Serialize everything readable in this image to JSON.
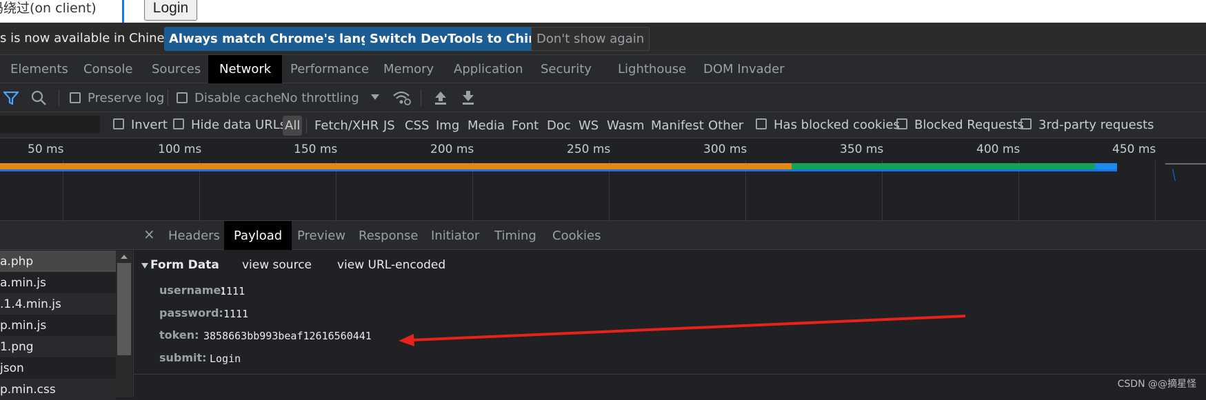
{
  "page": {
    "hint_text": "码绕过(on client)",
    "login_label": "Login"
  },
  "lang_bar": {
    "message": "s is now available in Chinese!",
    "btn_match": "Always match Chrome's language",
    "btn_switch": "Switch DevTools to Chinese",
    "btn_dismiss": "Don't show again",
    "accent": "#1a5c93"
  },
  "main_tabs": [
    "Elements",
    "Console",
    "Sources",
    "Network",
    "Performance",
    "Memory",
    "Application",
    "Security",
    "Lighthouse",
    "DOM Invader"
  ],
  "active_main_tab": "Network",
  "toolbar": {
    "preserve_log": "Preserve log",
    "disable_cache": "Disable cache",
    "throttling": "No throttling"
  },
  "filter": {
    "invert": "Invert",
    "hide_data_urls": "Hide data URLs",
    "types": [
      "All",
      "Fetch/XHR",
      "JS",
      "CSS",
      "Img",
      "Media",
      "Font",
      "Doc",
      "WS",
      "Wasm",
      "Manifest",
      "Other"
    ],
    "active_type": "All",
    "has_blocked_cookies": "Has blocked cookies",
    "blocked_requests": "Blocked Requests",
    "third_party": "3rd-party requests"
  },
  "timeline": {
    "ticks": [
      "50 ms",
      "100 ms",
      "150 ms",
      "200 ms",
      "250 ms",
      "300 ms",
      "350 ms",
      "400 ms",
      "450 ms"
    ],
    "colors": {
      "waiting": "#e48a13",
      "download": "#10a45a",
      "content": "#1a8cf0",
      "queue": "#1a73e8"
    }
  },
  "requests": [
    "a.php",
    "a.min.js",
    ".1.4.min.js",
    "p.min.js",
    "1.png",
    "json",
    "p.min.css"
  ],
  "detail_tabs": [
    "Headers",
    "Payload",
    "Preview",
    "Response",
    "Initiator",
    "Timing",
    "Cookies"
  ],
  "active_detail_tab": "Payload",
  "form_data": {
    "title": "Form Data",
    "view_source": "view source",
    "view_url_encoded": "view URL-encoded",
    "fields": [
      {
        "key": "username:",
        "value": "1111"
      },
      {
        "key": "password:",
        "value": "1111"
      },
      {
        "key": "token:",
        "value": "3858663bb993beaf12616560441"
      },
      {
        "key": "submit:",
        "value": "Login"
      }
    ]
  },
  "annotation": {
    "arrow_color": "#e8211b"
  },
  "watermark": "CSDN @@摘星怪"
}
